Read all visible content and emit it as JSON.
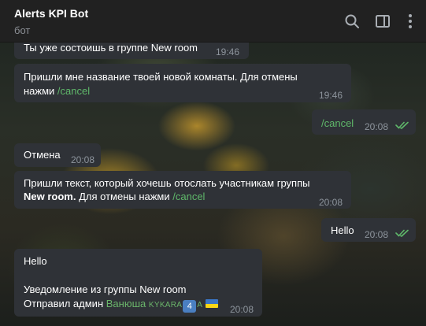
{
  "header": {
    "title": "Alerts KPI Bot",
    "status": "бот",
    "icons": [
      "search-icon",
      "sidebar-toggle-icon",
      "more-vertical-icon"
    ]
  },
  "messages": [
    {
      "id": "m1",
      "direction": "in",
      "text": "Ты уже состоишь в группе New room",
      "time": "19:46"
    },
    {
      "id": "m2",
      "direction": "in",
      "line1": "Пришли мне название твоей новой комнаты. Для отмены",
      "line2_prefix": "нажми ",
      "command": "/cancel",
      "time": "19:46"
    },
    {
      "id": "m3",
      "direction": "out",
      "command": "/cancel",
      "time": "20:08",
      "read": true
    },
    {
      "id": "m4",
      "direction": "in",
      "text": "Отмена",
      "time": "20:08"
    },
    {
      "id": "m5",
      "direction": "in",
      "line1": "Пришли текст, который хочешь отослать участникам группы",
      "line2_bold": "New room.",
      "line2_middle": " Для отмены нажми ",
      "command": "/cancel",
      "time": "20:08"
    },
    {
      "id": "m6",
      "direction": "out",
      "text": "Hello",
      "time": "20:08",
      "read": true
    },
    {
      "id": "m7",
      "direction": "in",
      "line1": "Hello",
      "line3": "Уведомление из группы New room",
      "line4_prefix": "Отправил админ ",
      "sender_name": "Ванюша",
      "sender_tag": "KYKARA",
      "badge": "4",
      "sender_suffix": "A",
      "time": "20:08"
    }
  ],
  "colors": {
    "header_bg": "#212121",
    "bubble_in": "#2f3237",
    "link": "#6ab46a",
    "time": "#8d949c",
    "read_check": "#5fb86a"
  }
}
